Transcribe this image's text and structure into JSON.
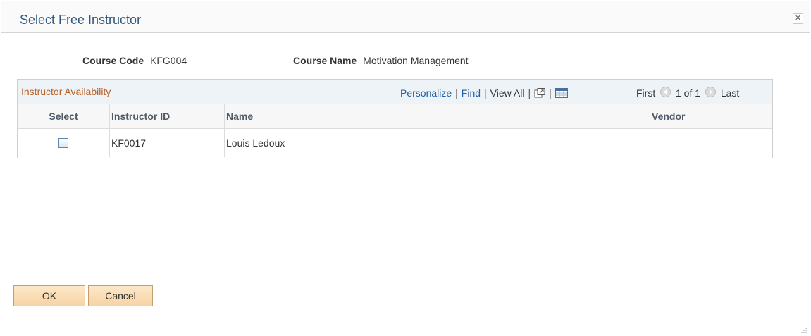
{
  "dialog": {
    "title": "Select Free Instructor"
  },
  "course": {
    "code_label": "Course Code",
    "code_value": "KFG004",
    "name_label": "Course Name",
    "name_value": "Motivation Management"
  },
  "grid": {
    "title": "Instructor Availability",
    "toolbar": {
      "personalize": "Personalize",
      "find": "Find",
      "view_all": "View All"
    },
    "pager": {
      "first": "First",
      "range": "1 of 1",
      "last": "Last"
    },
    "columns": [
      "Select",
      "Instructor ID",
      "Name",
      "Vendor"
    ],
    "rows": [
      {
        "selected": false,
        "instructor_id": "KF0017",
        "name": "Louis Ledoux",
        "vendor": ""
      }
    ]
  },
  "buttons": {
    "ok": "OK",
    "cancel": "Cancel"
  }
}
